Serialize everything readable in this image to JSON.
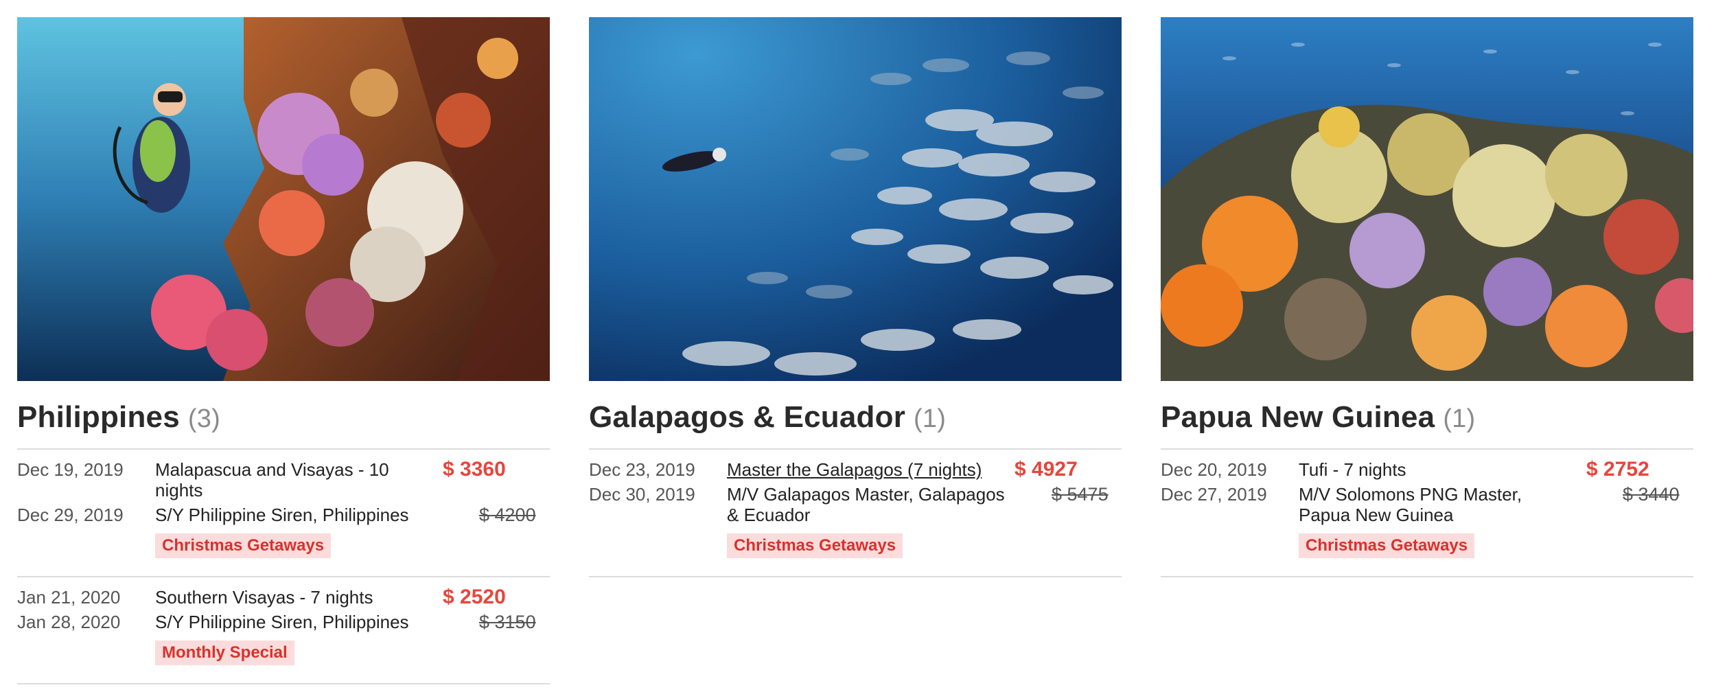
{
  "colors": {
    "accent": "#e8453c",
    "badge_bg": "#fbdcdc",
    "badge_text": "#d8322b",
    "divider": "#dcdcdc"
  },
  "cards": [
    {
      "title": "Philippines",
      "count": "(3)",
      "trips": [
        {
          "start": "Dec 19, 2019",
          "end": "Dec 29, 2019",
          "name_line1": "Malapascua and Visayas - 10",
          "name_line2": "nights",
          "vessel": "S/Y Philippine Siren, Philippines",
          "price": "$ 3360",
          "old_price": "$ 4200",
          "badge": "Christmas Getaways"
        },
        {
          "start": "Jan 21, 2020",
          "end": "Jan 28, 2020",
          "name": "Southern Visayas - 7 nights",
          "vessel": "S/Y Philippine Siren, Philippines",
          "price": "$ 2520",
          "old_price": "$ 3150",
          "badge": "Monthly Special"
        }
      ]
    },
    {
      "title": "Galapagos & Ecuador",
      "count": "(1)",
      "trips": [
        {
          "start": "Dec 23, 2019",
          "end": "Dec 30, 2019",
          "name": "Master the Galapagos (7 nights)",
          "vessel_line1": "M/V Galapagos Master, Galapagos",
          "vessel_line2": "& Ecuador",
          "price": "$ 4927",
          "old_price": "$ 5475",
          "badge": "Christmas Getaways"
        }
      ]
    },
    {
      "title": "Papua New Guinea",
      "count": "(1)",
      "trips": [
        {
          "start": "Dec 20, 2019",
          "end": "Dec 27, 2019",
          "name": "Tufi - 7 nights",
          "vessel_line1": "M/V Solomons PNG Master,",
          "vessel_line2": "Papua New Guinea",
          "price": "$ 2752",
          "old_price": "$ 3440",
          "badge": "Christmas Getaways"
        }
      ]
    }
  ]
}
